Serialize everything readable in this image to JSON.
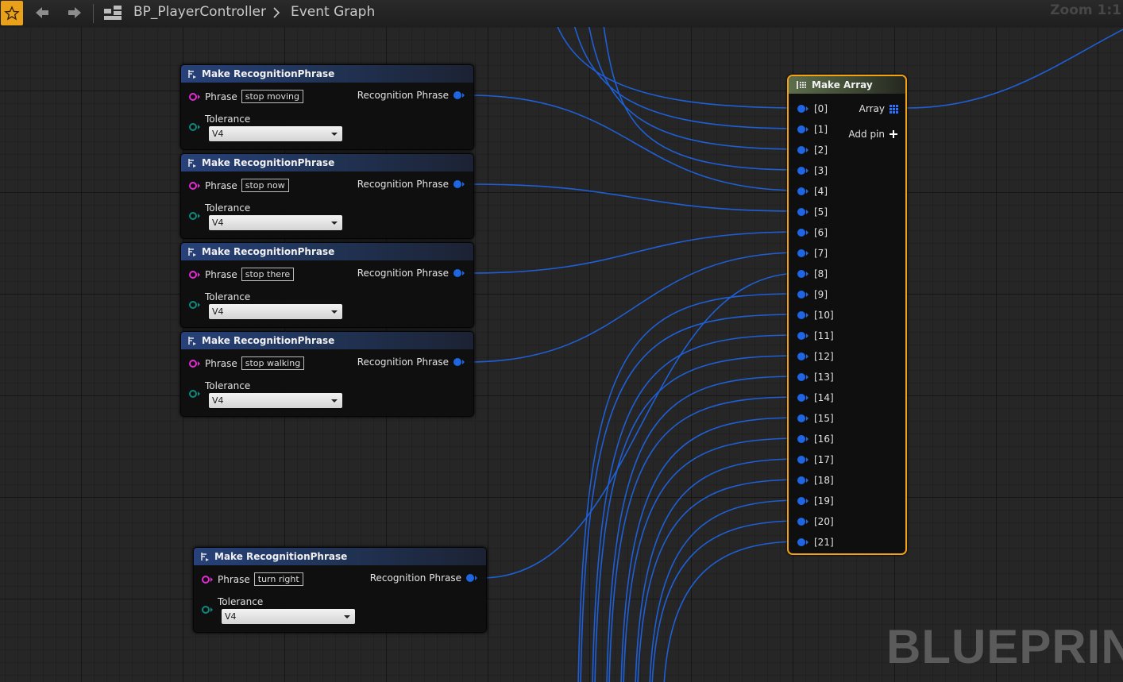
{
  "toolbar": {
    "breadcrumb_blueprint": "BP_PlayerController",
    "breadcrumb_graph": "Event Graph",
    "zoom": "Zoom 1:1"
  },
  "watermark": "BLUEPRINT",
  "nodes": [
    {
      "title": "Make RecognitionPhrase",
      "phrase_label": "Phrase",
      "phrase_value": "stop moving",
      "tolerance_label": "Tolerance",
      "tolerance_value": "V4",
      "output_label": "Recognition Phrase"
    },
    {
      "title": "Make RecognitionPhrase",
      "phrase_label": "Phrase",
      "phrase_value": "stop now",
      "tolerance_label": "Tolerance",
      "tolerance_value": "V4",
      "output_label": "Recognition Phrase"
    },
    {
      "title": "Make RecognitionPhrase",
      "phrase_label": "Phrase",
      "phrase_value": "stop there",
      "tolerance_label": "Tolerance",
      "tolerance_value": "V4",
      "output_label": "Recognition Phrase"
    },
    {
      "title": "Make RecognitionPhrase",
      "phrase_label": "Phrase",
      "phrase_value": "stop walking",
      "tolerance_label": "Tolerance",
      "tolerance_value": "V4",
      "output_label": "Recognition Phrase"
    },
    {
      "title": "Make RecognitionPhrase",
      "phrase_label": "Phrase",
      "phrase_value": "turn right",
      "tolerance_label": "Tolerance",
      "tolerance_value": "V4",
      "output_label": "Recognition Phrase"
    }
  ],
  "make_array": {
    "title": "Make Array",
    "output_label": "Array",
    "add_pin_label": "Add pin",
    "pins": [
      "[0]",
      "[1]",
      "[2]",
      "[3]",
      "[4]",
      "[5]",
      "[6]",
      "[7]",
      "[8]",
      "[9]",
      "[10]",
      "[11]",
      "[12]",
      "[13]",
      "[14]",
      "[15]",
      "[16]",
      "[17]",
      "[18]",
      "[19]",
      "[20]",
      "[21]"
    ]
  },
  "colors": {
    "struct_pin": "#1e66e4",
    "text_pin": "#e12bd6",
    "enum_pin": "#0b8a7e",
    "selection": "#f2a212",
    "favorite": "#e9a11c"
  },
  "icons": [
    "star-icon",
    "back-arrow-icon",
    "forward-arrow-icon",
    "blueprint-icon",
    "chevron-right-icon",
    "function-icon",
    "make-array-icon",
    "array-grid-icon",
    "plus-icon"
  ]
}
